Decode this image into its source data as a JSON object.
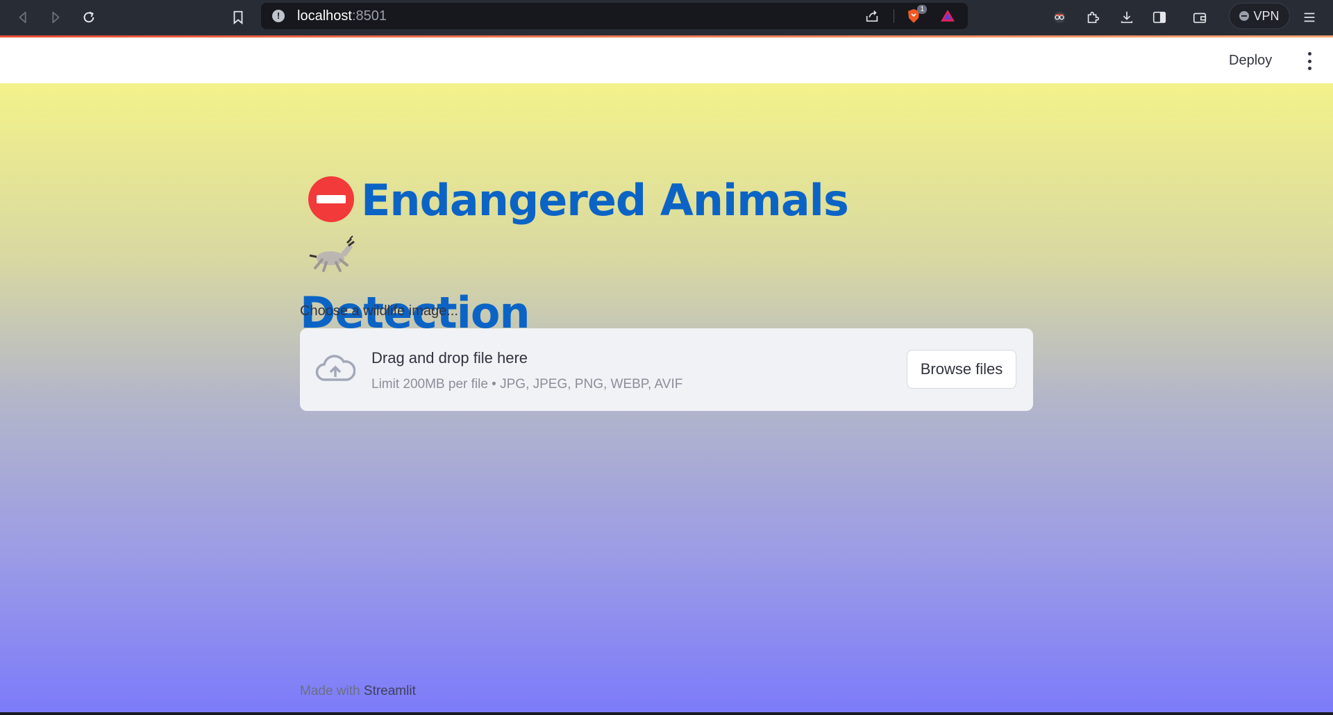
{
  "browser": {
    "url_host": "localhost",
    "url_port": ":8501",
    "brave_badge_count": "1",
    "vpn_label": "VPN"
  },
  "header": {
    "deploy_label": "Deploy"
  },
  "main": {
    "title_line1": "Endangered Animals",
    "title_line2": "Detection",
    "title_icon_left": "no-entry-emoji",
    "title_icon_right": "horse-emoji",
    "uploader": {
      "label": "Choose a wildlife image...",
      "drop_text": "Drag and drop file here",
      "limit_text": "Limit 200MB per file • JPG, JPEG, PNG, WEBP, AVIF",
      "browse_label": "Browse files"
    }
  },
  "footer": {
    "made_with": "Made with",
    "brand": "Streamlit"
  },
  "colors": {
    "title": "#0b64c5",
    "gradient_top": "#f3f28a",
    "gradient_bottom": "#7c7bfa",
    "chrome_bg": "#282c34"
  }
}
